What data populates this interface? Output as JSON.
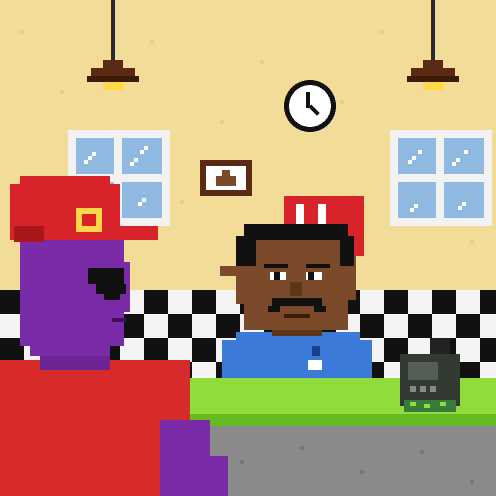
{
  "scene": {
    "type": "pixel-art game scene",
    "setting": "diner counter",
    "palette": {
      "wall": "#f3dc98",
      "wall_speckle": "#e9cd83",
      "checker_dark": "#111111",
      "checker_light": "#f4f4f4",
      "counter_top": "#8fdc3a",
      "counter_front": "#66bb22",
      "floor": "#8a8a8a",
      "window_frame": "#f2f2f2",
      "window_glass": "#8fb9e0",
      "lamp_shade": "#5a2a12",
      "lamp_bulb": "#ffd84a",
      "alien_skin": "#7a2ca8",
      "alien_shirt": "#d82a2a",
      "cap_red": "#d8232a",
      "cashier_skin": "#7a4a2a",
      "cashier_shirt": "#3b7ad8",
      "register": "#333a33"
    },
    "characters": [
      {
        "name": "alien-customer",
        "icon": "purple-alien-with-red-cap"
      },
      {
        "name": "cashier",
        "icon": "mustached-man-blue-shirt"
      }
    ],
    "props": [
      "pendant-lamp-left",
      "pendant-lamp-right",
      "wall-clock",
      "framed-picture",
      "window-left",
      "window-right",
      "red-menu-board",
      "cash-register",
      "counter"
    ]
  }
}
